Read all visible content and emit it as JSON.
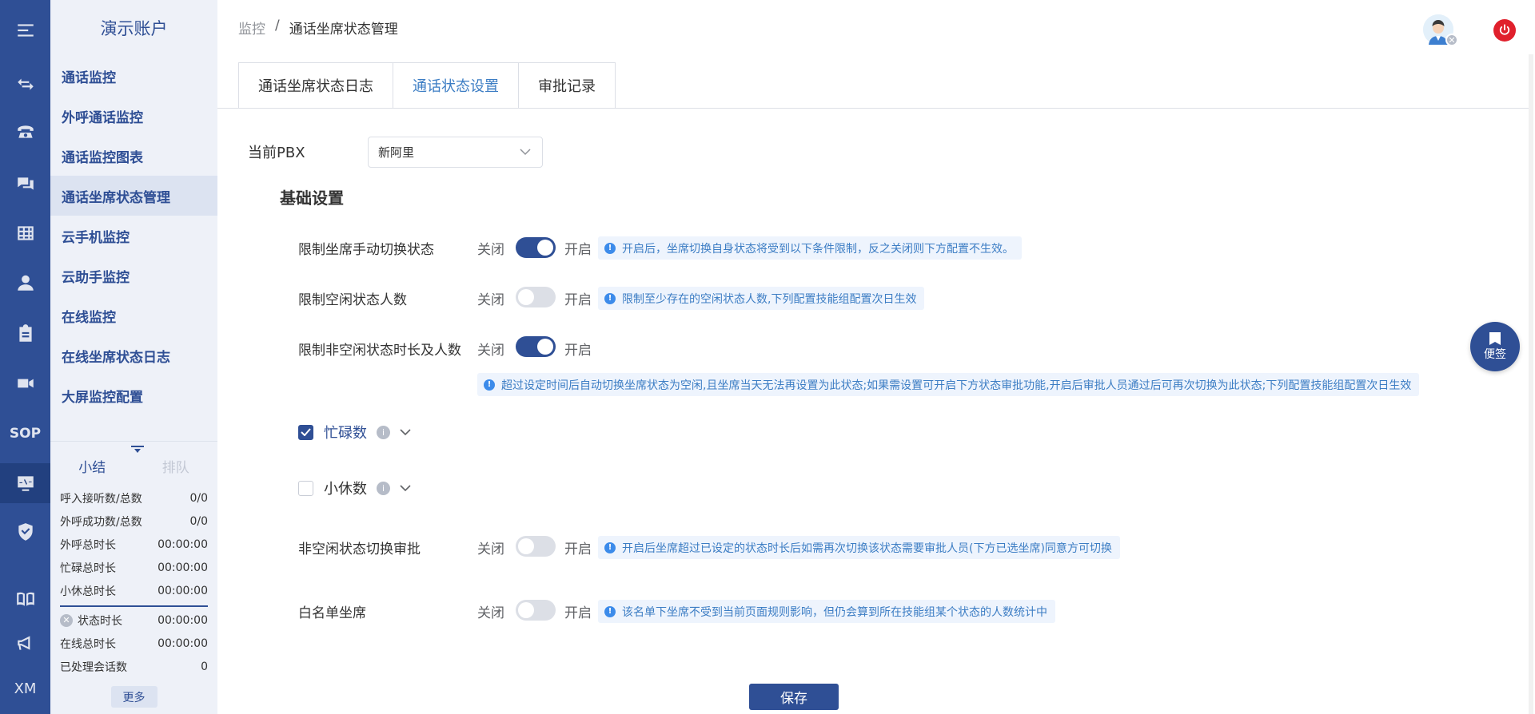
{
  "sidebar": {
    "account": "演示账户",
    "rail": {
      "sop": "SOP",
      "xm": "XM"
    },
    "menu": [
      {
        "label": "通话监控"
      },
      {
        "label": "外呼通话监控"
      },
      {
        "label": "通话监控图表"
      },
      {
        "label": "通话坐席状态管理"
      },
      {
        "label": "云手机监控"
      },
      {
        "label": "云助手监控"
      },
      {
        "label": "在线监控"
      },
      {
        "label": "在线坐席状态日志"
      },
      {
        "label": "大屏监控配置"
      }
    ],
    "summary": {
      "tabs": [
        "小结",
        "排队"
      ],
      "rows": [
        {
          "label": "呼入接听数/总数",
          "value": "0/0"
        },
        {
          "label": "外呼成功数/总数",
          "value": "0/0"
        },
        {
          "label": "外呼总时长",
          "value": "00:00:00"
        },
        {
          "label": "忙碌总时长",
          "value": "00:00:00"
        },
        {
          "label": "小休总时长",
          "value": "00:00:00"
        }
      ],
      "rows2": [
        {
          "label": "状态时长",
          "value": "00:00:00"
        },
        {
          "label": "在线总时长",
          "value": "00:00:00"
        },
        {
          "label": "已处理会话数",
          "value": "0"
        }
      ],
      "more": "更多"
    }
  },
  "header": {
    "breadcrumb": [
      "监控",
      "/",
      "通话坐席状态管理"
    ]
  },
  "tabs": [
    {
      "label": "通话坐席状态日志"
    },
    {
      "label": "通话状态设置"
    },
    {
      "label": "审批记录"
    }
  ],
  "form": {
    "pbx_label": "当前PBX",
    "pbx_value": "新阿里",
    "section_title": "基础设置",
    "off_label": "关闭",
    "on_label": "开启",
    "rows": [
      {
        "label": "限制坐席手动切换状态",
        "enabled": true,
        "tip": "开启后，坐席切换自身状态将受到以下条件限制，反之关闭则下方配置不生效。"
      },
      {
        "label": "限制空闲状态人数",
        "enabled": false,
        "tip": "限制至少存在的空闲状态人数,下列配置技能组配置次日生效"
      },
      {
        "label": "限制非空闲状态时长及人数",
        "enabled": true,
        "tip": "超过设定时间后自动切换坐席状态为空闲,且坐席当天无法再设置为此状态;如果需设置可开启下方状态审批功能,开启后审批人员通过后可再次切换为此状态;下列配置技能组配置次日生效"
      },
      {
        "label": "非空闲状态切换审批",
        "enabled": false,
        "tip": "开启后坐席超过已设定的状态时长后如需再次切换该状态需要审批人员(下方已选坐席)同意方可切换"
      },
      {
        "label": "白名单坐席",
        "enabled": false,
        "tip": "该名单下坐席不受到当前页面规则影响，但仍会算到所在技能组某个状态的人数统计中"
      }
    ],
    "checks": [
      {
        "label": "忙碌数",
        "checked": true
      },
      {
        "label": "小休数",
        "checked": false
      }
    ],
    "save": "保存"
  },
  "note_button": "便签",
  "colors": {
    "primary": "#2f4f95",
    "sidebar_bg": "#eef1f8",
    "tip_text": "#3c7dc4",
    "power": "#e0202c"
  }
}
